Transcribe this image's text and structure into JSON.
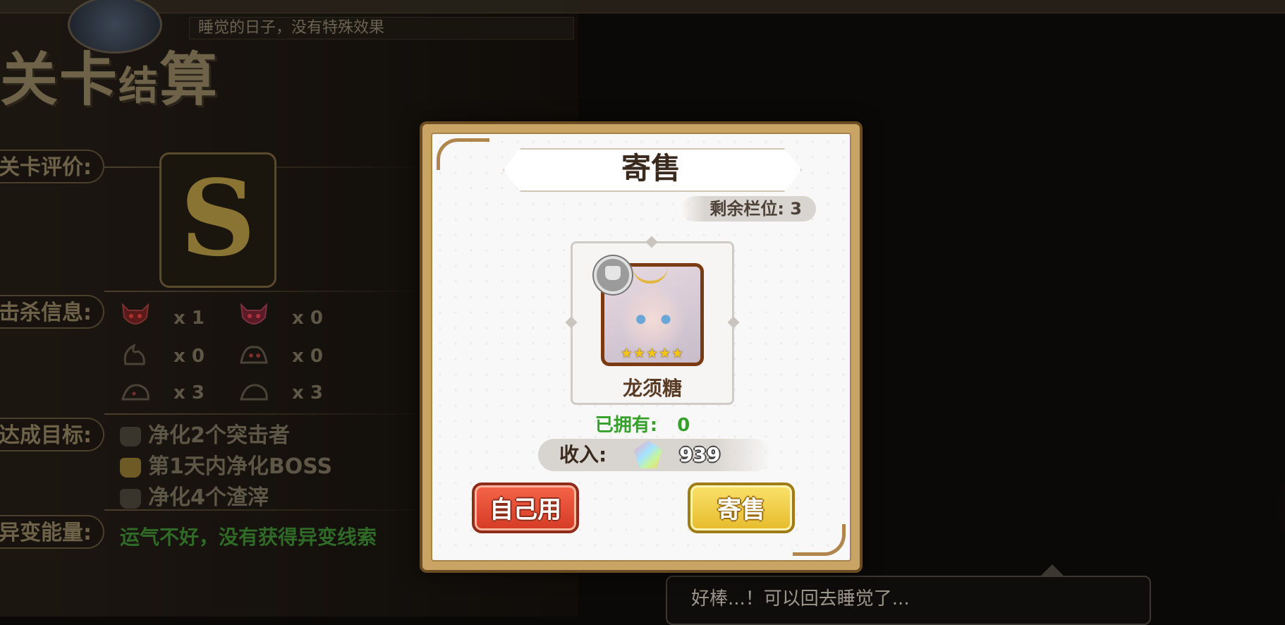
{
  "background": {
    "top_subtitle": "睡觉的日子，没有特殊效果",
    "title_big": "关卡",
    "title_small": "结",
    "title_big2": "算",
    "rows": {
      "rating_label": "关卡评价:",
      "kill_label": "击杀信息:",
      "goal_label": "达成目标:",
      "energy_label": "异变能量:"
    },
    "grade": "S",
    "kills": [
      {
        "icon": "demon-mask-icon",
        "count": "x 1"
      },
      {
        "icon": "demon-mask-icon",
        "count": "x 0"
      },
      {
        "icon": "flame-beast-icon",
        "count": "x 0"
      },
      {
        "icon": "horned-blob-icon",
        "count": "x 0"
      },
      {
        "icon": "slime-icon",
        "count": "x 3"
      },
      {
        "icon": "slime-icon",
        "count": "x 3"
      }
    ],
    "goals": [
      {
        "text": "净化2个突击者",
        "done": false
      },
      {
        "text": "第1天内净化BOSS",
        "done": true
      },
      {
        "text": "净化4个渣滓",
        "done": false
      }
    ],
    "energy_text": "运气不好，没有获得异变线索",
    "speech": "好棒...！可以回去睡觉了..."
  },
  "dialog": {
    "title": "寄售",
    "slots": "剩余栏位: 3",
    "item": {
      "name": "龙须糖",
      "stars": "★★★★★",
      "star_count": 5
    },
    "owned_label": "已拥有:",
    "owned_value": "0",
    "income_label": "收入:",
    "income_value": "939",
    "button_self": "自己用",
    "button_sell": "寄售"
  },
  "colors": {
    "accent_gold": "#c9a465",
    "sell_button": "#e5bb2a",
    "self_button": "#d43a24",
    "owned_green": "#35a12b"
  }
}
